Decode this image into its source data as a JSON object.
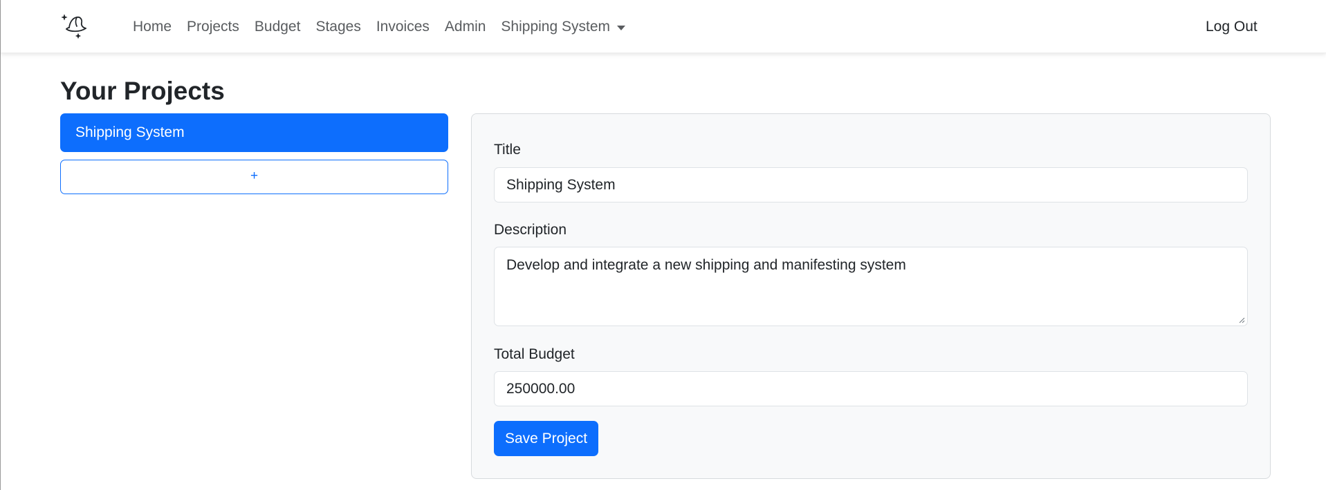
{
  "navbar": {
    "brand_icon": "wizard-hat-sparkle-icon",
    "links": [
      "Home",
      "Projects",
      "Budget",
      "Stages",
      "Invoices",
      "Admin"
    ],
    "dropdown_label": "Shipping System",
    "logout_label": "Log Out"
  },
  "page": {
    "title": "Your Projects"
  },
  "projects": {
    "items": [
      "Shipping System"
    ],
    "add_label": "+"
  },
  "form": {
    "title_label": "Title",
    "title_value": "Shipping System",
    "description_label": "Description",
    "description_value": "Develop and integrate a new shipping and manifesting system",
    "budget_label": "Total Budget",
    "budget_value": "250000.00",
    "save_label": "Save Project"
  },
  "colors": {
    "primary": "#0d6efd",
    "card_bg": "#f8f9fa",
    "nav_text": "#595c5f"
  }
}
